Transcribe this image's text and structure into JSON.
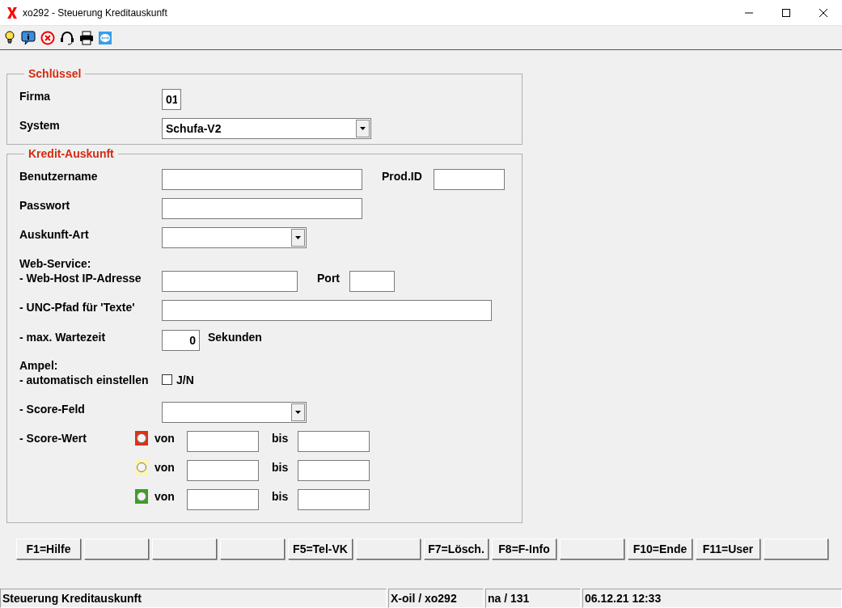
{
  "window": {
    "title": "xo292 - Steuerung Kreditauskunft"
  },
  "schluessel": {
    "title": "Schlüssel",
    "firma": {
      "label": "Firma",
      "value": "01"
    },
    "system": {
      "label": "System",
      "value": "Schufa-V2"
    }
  },
  "kredit": {
    "title": "Kredit-Auskunft",
    "benutzername": {
      "label": "Benutzername"
    },
    "prod_id": {
      "label": "Prod.ID"
    },
    "passwort": {
      "label": "Passwort"
    },
    "auskunft_art": {
      "label": "Auskunft-Art"
    },
    "web_service_heading": "Web-Service:",
    "web_host": {
      "label": "- Web-Host IP-Adresse"
    },
    "port": {
      "label": "Port"
    },
    "unc": {
      "label": "- UNC-Pfad für 'Texte'"
    },
    "wartezeit": {
      "label": "- max. Wartezeit",
      "value": "0",
      "unit": "Sekunden"
    },
    "ampel_heading": "Ampel:",
    "automatisch": {
      "label": "- automatisch einstellen",
      "checked": false,
      "checkbox_label": "J/N"
    },
    "score_feld": {
      "label": "- Score-Feld"
    },
    "score_wert": {
      "label": "- Score-Wert",
      "rows": [
        {
          "color": "#e03010",
          "selected": false,
          "von": "von",
          "bis": "bis"
        },
        {
          "color": "#fff5a8",
          "selected": false,
          "von": "von",
          "bis": "bis"
        },
        {
          "color": "#3aa020",
          "selected": false,
          "von": "von",
          "bis": "bis"
        }
      ]
    }
  },
  "function_keys": [
    {
      "kind": "labeled",
      "label": "F1=Hilfe"
    },
    {
      "kind": "blank"
    },
    {
      "kind": "blank"
    },
    {
      "kind": "blank"
    },
    {
      "kind": "labeled",
      "label": "F5=Tel-VK"
    },
    {
      "kind": "blank"
    },
    {
      "kind": "labeled",
      "label": "F7=Lösch."
    },
    {
      "kind": "labeled",
      "label": "F8=F-Info"
    },
    {
      "kind": "blank"
    },
    {
      "kind": "labeled",
      "label": "F10=Ende"
    },
    {
      "kind": "labeled",
      "label": "F11=User"
    },
    {
      "kind": "blank"
    }
  ],
  "status_bar": [
    "Steuerung Kreditauskunft",
    "X-oil / xo292",
    "na / 131",
    "06.12.21 12:33"
  ]
}
